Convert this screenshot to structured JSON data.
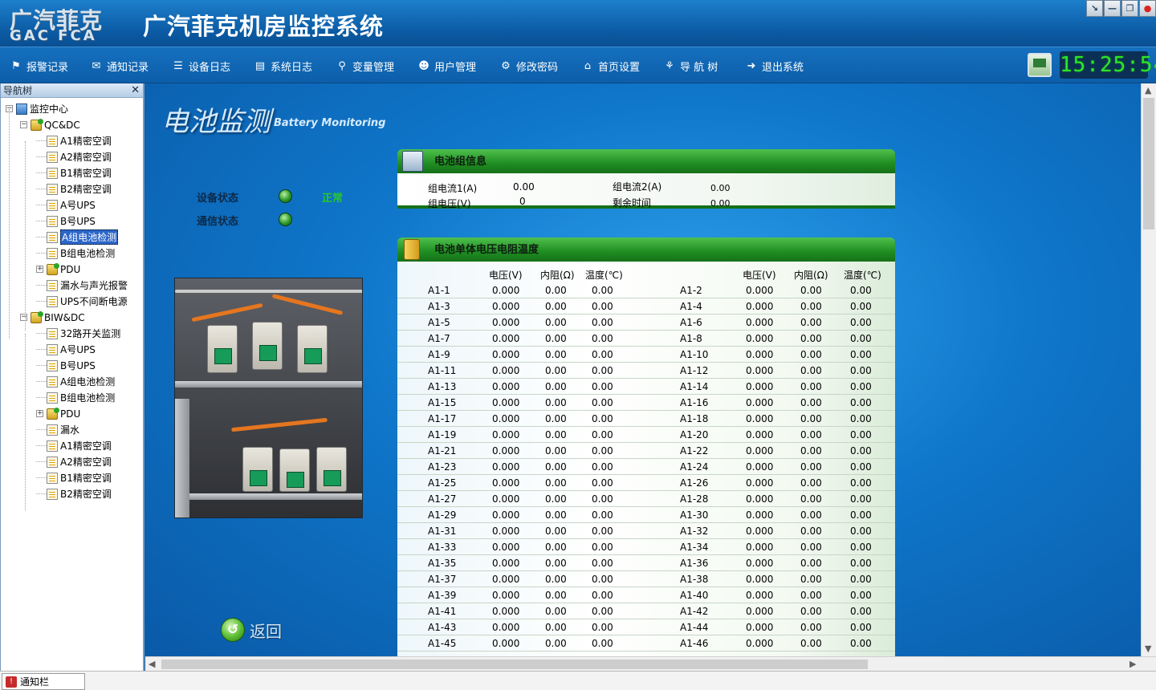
{
  "app": {
    "logo_cn": "广汽菲克",
    "logo_en": "GAC FCA",
    "title": "广汽菲克机房监控系统",
    "window_controls": [
      "↘",
      "—",
      "❐",
      "●"
    ]
  },
  "menu": [
    {
      "label": "报警记录",
      "icon": "flag-icon",
      "glyph": "⚑"
    },
    {
      "label": "通知记录",
      "icon": "mail-icon",
      "glyph": "✉"
    },
    {
      "label": "设备日志",
      "icon": "list-icon",
      "glyph": "☰"
    },
    {
      "label": "系统日志",
      "icon": "log-icon",
      "glyph": "▤"
    },
    {
      "label": "变量管理",
      "icon": "link-icon",
      "glyph": "⚲"
    },
    {
      "label": "用户管理",
      "icon": "users-icon",
      "glyph": "☻"
    },
    {
      "label": "修改密码",
      "icon": "gear-icon",
      "glyph": "⚙"
    },
    {
      "label": "首页设置",
      "icon": "home-icon",
      "glyph": "⌂"
    },
    {
      "label": "导 航 树",
      "icon": "tree-icon",
      "glyph": "⚘"
    },
    {
      "label": "退出系统",
      "icon": "exit-icon",
      "glyph": "➜"
    }
  ],
  "clock": "15:25:54",
  "nav": {
    "title": "导航树",
    "close": "✕",
    "tree": [
      {
        "label": "监控中心",
        "level": 0,
        "icon": "pc",
        "box": "−"
      },
      {
        "label": "QC&DC",
        "level": 1,
        "icon": "grp",
        "box": "−"
      },
      {
        "label": "A1精密空调",
        "level": 2,
        "icon": "doc"
      },
      {
        "label": "A2精密空调",
        "level": 2,
        "icon": "doc"
      },
      {
        "label": "B1精密空调",
        "level": 2,
        "icon": "doc"
      },
      {
        "label": "B2精密空调",
        "level": 2,
        "icon": "doc"
      },
      {
        "label": "A号UPS",
        "level": 2,
        "icon": "doc"
      },
      {
        "label": "B号UPS",
        "level": 2,
        "icon": "doc"
      },
      {
        "label": "A组电池检测",
        "level": 2,
        "icon": "doc",
        "selected": true
      },
      {
        "label": "B组电池检测",
        "level": 2,
        "icon": "doc"
      },
      {
        "label": "PDU",
        "level": 2,
        "icon": "grp",
        "box": "+"
      },
      {
        "label": "漏水与声光报警",
        "level": 2,
        "icon": "doc"
      },
      {
        "label": "UPS不间断电源",
        "level": 2,
        "icon": "doc"
      },
      {
        "label": "BIW&DC",
        "level": 1,
        "icon": "grp",
        "box": "−"
      },
      {
        "label": "32路开关监测",
        "level": 2,
        "icon": "doc"
      },
      {
        "label": "A号UPS",
        "level": 2,
        "icon": "doc"
      },
      {
        "label": "B号UPS",
        "level": 2,
        "icon": "doc"
      },
      {
        "label": "A组电池检测",
        "level": 2,
        "icon": "doc"
      },
      {
        "label": "B组电池检测",
        "level": 2,
        "icon": "doc"
      },
      {
        "label": "PDU",
        "level": 2,
        "icon": "grp",
        "box": "+"
      },
      {
        "label": "漏水",
        "level": 2,
        "icon": "doc"
      },
      {
        "label": "A1精密空调",
        "level": 2,
        "icon": "doc"
      },
      {
        "label": "A2精密空调",
        "level": 2,
        "icon": "doc"
      },
      {
        "label": "B1精密空调",
        "level": 2,
        "icon": "doc"
      },
      {
        "label": "B2精密空调",
        "level": 2,
        "icon": "doc"
      }
    ]
  },
  "page": {
    "title": "电池监测",
    "subtitle": "Battery Monitoring",
    "device_status_label": "设备状态",
    "comm_status_label": "通信状态",
    "device_status_value": "正常",
    "return_label": "返回"
  },
  "group_info": {
    "title": "电池组信息",
    "current1_label": "组电流1(A)",
    "current1_value": "0.00",
    "current2_label": "组电流2(A)",
    "current2_value": "0.00",
    "voltage_label": "组电压(V)",
    "voltage_value": "0",
    "remain_label": "剩余时间",
    "remain_value": "0.00"
  },
  "cells": {
    "title": "电池单体电压电阻温度",
    "headers": [
      "电压(V)",
      "内阻(Ω)",
      "温度(℃)"
    ],
    "voltage": "0.000",
    "resistance": "0.00",
    "temperature": "0.00",
    "rows": [
      [
        "A1-1",
        "A1-2"
      ],
      [
        "A1-3",
        "A1-4"
      ],
      [
        "A1-5",
        "A1-6"
      ],
      [
        "A1-7",
        "A1-8"
      ],
      [
        "A1-9",
        "A1-10"
      ],
      [
        "A1-11",
        "A1-12"
      ],
      [
        "A1-13",
        "A1-14"
      ],
      [
        "A1-15",
        "A1-16"
      ],
      [
        "A1-17",
        "A1-18"
      ],
      [
        "A1-19",
        "A1-20"
      ],
      [
        "A1-21",
        "A1-22"
      ],
      [
        "A1-23",
        "A1-24"
      ],
      [
        "A1-25",
        "A1-26"
      ],
      [
        "A1-27",
        "A1-28"
      ],
      [
        "A1-29",
        "A1-30"
      ],
      [
        "A1-31",
        "A1-32"
      ],
      [
        "A1-33",
        "A1-34"
      ],
      [
        "A1-35",
        "A1-36"
      ],
      [
        "A1-37",
        "A1-38"
      ],
      [
        "A1-39",
        "A1-40"
      ],
      [
        "A1-41",
        "A1-42"
      ],
      [
        "A1-43",
        "A1-44"
      ],
      [
        "A1-45",
        "A1-46"
      ]
    ]
  },
  "statusbar": {
    "tab_label": "通知栏"
  }
}
